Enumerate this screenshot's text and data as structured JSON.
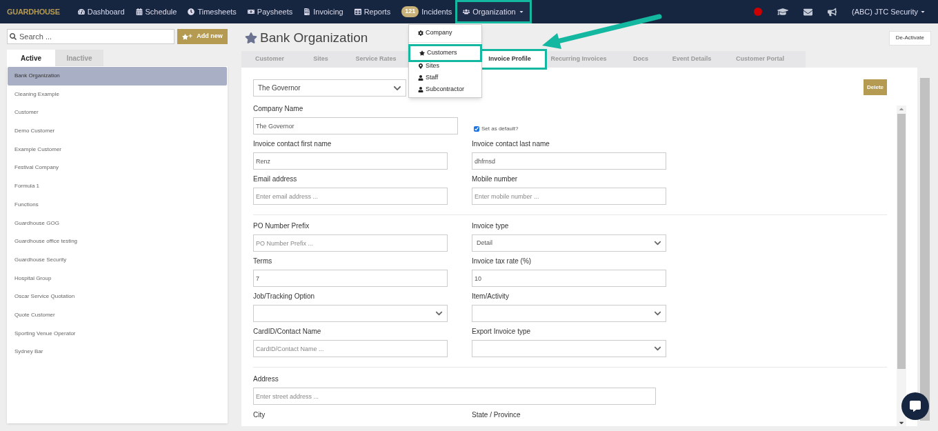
{
  "navbar": {
    "logo": "GUARDHOUSE",
    "items": [
      {
        "label": "Dashboard",
        "selected": false
      },
      {
        "label": "Schedule",
        "selected": false
      },
      {
        "label": "Timesheets",
        "selected": false
      },
      {
        "label": "Paysheets",
        "selected": false
      },
      {
        "label": "Invoicing",
        "selected": false
      },
      {
        "label": "Reports",
        "selected": false
      },
      {
        "label": "Incidents",
        "badge": "121",
        "selected": false
      },
      {
        "label": "Organization",
        "selected": true
      }
    ],
    "account": "(ABC) JTC Security",
    "org_menu": {
      "expanded": true,
      "items": [
        {
          "label": "Company"
        },
        {
          "label": "Customers"
        },
        {
          "label": "Sites"
        },
        {
          "label": "Staff"
        },
        {
          "label": "Subcontractor"
        }
      ]
    }
  },
  "sidebar": {
    "search": {
      "placeholder": "Search ..."
    },
    "add_button": "Add new",
    "tabs": [
      {
        "label": "Active",
        "selected": true
      },
      {
        "label": "Inactive",
        "selected": false
      }
    ],
    "items": [
      {
        "label": "Bank Organization",
        "selected": true
      },
      {
        "label": "Cleaning Example",
        "selected": false
      },
      {
        "label": "Customer",
        "selected": false
      },
      {
        "label": "Demo Customer",
        "selected": false
      },
      {
        "label": "Example Customer",
        "selected": false
      },
      {
        "label": "Festival Company",
        "selected": false
      },
      {
        "label": "Formula 1",
        "selected": false
      },
      {
        "label": "Functions",
        "selected": false
      },
      {
        "label": "Guardhouse GOG",
        "selected": false
      },
      {
        "label": "Guardhouse office testing",
        "selected": false
      },
      {
        "label": "Guardhouse Security",
        "selected": false
      },
      {
        "label": "Hospital Group",
        "selected": false
      },
      {
        "label": "Oscar Service Quotation",
        "selected": false
      },
      {
        "label": "Quote Customer",
        "selected": false
      },
      {
        "label": "Sporting Venue Operator",
        "selected": false
      },
      {
        "label": "Sydney Bar",
        "selected": false
      }
    ]
  },
  "main": {
    "title": "Bank Organization",
    "deactivate_button": "De-Activate",
    "tabs": [
      {
        "label": "Customer",
        "selected": false
      },
      {
        "label": "Sites",
        "selected": false
      },
      {
        "label": "Service Rates",
        "selected": false
      },
      {
        "label": "Invoice Profile",
        "selected": true
      },
      {
        "label": "Recurring Invoices",
        "selected": false
      },
      {
        "label": "Docs",
        "selected": false
      },
      {
        "label": "Event Details",
        "selected": false
      },
      {
        "label": "Customer Portal",
        "selected": false
      }
    ],
    "profile_select": "The Governor",
    "delete_button": "Delete",
    "company_name": {
      "label": "Company Name",
      "value": "The Governor"
    },
    "default_checkbox": {
      "label": "Set as default?",
      "checked": true
    },
    "sections": [
      {
        "rows": [
          [
            {
              "kind": "text",
              "label": "Invoice contact first name",
              "value": "Renz"
            },
            {
              "kind": "text",
              "label": "Invoice contact last name",
              "value": "dhfrnsd"
            }
          ],
          [
            {
              "kind": "text",
              "label": "Email address",
              "placeholder": "Enter email address ..."
            },
            {
              "kind": "text",
              "label": "Mobile number",
              "placeholder": "Enter mobile number ..."
            }
          ]
        ]
      },
      {
        "rows": [
          [
            {
              "kind": "text",
              "label": "PO Number Prefix",
              "placeholder": "PO Number Prefix ..."
            },
            {
              "kind": "select",
              "label": "Invoice type",
              "value": "Detail"
            }
          ],
          [
            {
              "kind": "text",
              "label": "Terms",
              "value": "7"
            },
            {
              "kind": "text",
              "label": "Invoice tax rate (%)",
              "value": "10"
            }
          ],
          [
            {
              "kind": "select",
              "label": "Job/Tracking Option"
            },
            {
              "kind": "select",
              "label": "Item/Activity"
            }
          ],
          [
            {
              "kind": "text",
              "label": "CardID/Contact Name",
              "placeholder": "CardID/Contact Name ..."
            },
            {
              "kind": "select",
              "label": "Export Invoice type"
            }
          ]
        ]
      }
    ],
    "address": {
      "label": "Address",
      "placeholder": "Enter street address ..."
    },
    "bottom_labels": [
      "City",
      "State / Province"
    ]
  }
}
